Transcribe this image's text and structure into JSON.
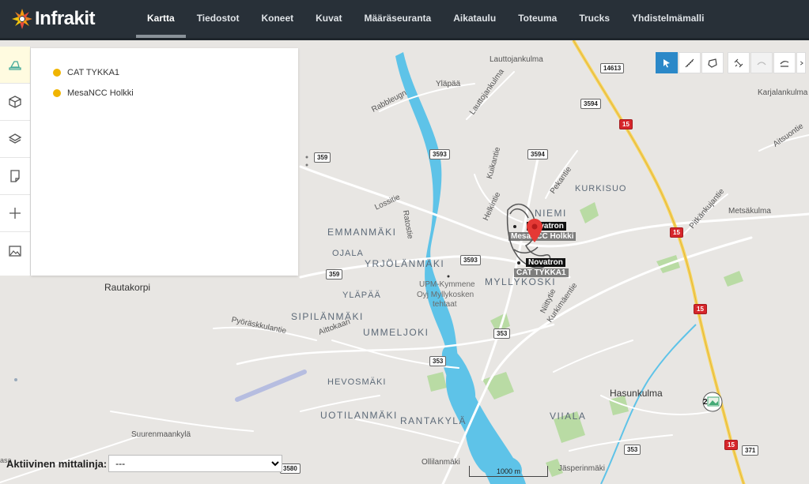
{
  "app": {
    "name": "Infrakit"
  },
  "nav": {
    "items": [
      {
        "label": "Kartta",
        "active": true
      },
      {
        "label": "Tiedostot",
        "active": false
      },
      {
        "label": "Koneet",
        "active": false
      },
      {
        "label": "Kuvat",
        "active": false
      },
      {
        "label": "Määräseuranta",
        "active": false
      },
      {
        "label": "Aikataulu",
        "active": false
      },
      {
        "label": "Toteuma",
        "active": false
      },
      {
        "label": "Trucks",
        "active": false
      },
      {
        "label": "Yhdistelmämalli",
        "active": false
      }
    ]
  },
  "left_tools": [
    {
      "icon": "machines-icon",
      "active": true
    },
    {
      "icon": "cube-icon",
      "active": false
    },
    {
      "icon": "layers-icon",
      "active": false
    },
    {
      "icon": "note-icon",
      "active": false
    },
    {
      "icon": "crosshair-icon",
      "active": false
    },
    {
      "icon": "image-icon",
      "active": false
    }
  ],
  "legend": {
    "items": [
      {
        "label": "CAT TYKKA1",
        "color": "#f0b400"
      },
      {
        "label": "MesaNCC Holkki",
        "color": "#f0b400"
      }
    ]
  },
  "map_tools": [
    {
      "icon": "pointer-icon",
      "active": true
    },
    {
      "icon": "measure-line-icon",
      "active": false
    },
    {
      "icon": "measure-area-icon",
      "active": false
    },
    {
      "icon": "satellite-icon",
      "active": false
    },
    {
      "icon": "profile-icon",
      "active": false
    },
    {
      "icon": "cross-section-icon",
      "active": false
    },
    {
      "icon": "more-icon",
      "active": false
    }
  ],
  "map": {
    "places": {
      "lauttojankulma": "Lauttojankulma",
      "ylapaa_top": "Yläpää",
      "rabbleugn": "Rabbleugn",
      "lauttojankulma_road": "Lauttojankulma",
      "karjalankulma": "Karjalankulma",
      "aitsuontie": "Aitsuontie",
      "kurkisuo": "KURKISUO",
      "pekantie": "Pekantie",
      "kuikantie": "Kuikantie",
      "helkintie": "Helkintie",
      "lossitie": "Lossitie",
      "ratostie": "Ratostie",
      "emmanmaki": "EMMANMÄKI",
      "ojala": "OJALA",
      "yrjolanmaki": "YRJÖLÄNMÄKI",
      "niemi": "NIEMI",
      "myllykoski": "MYLLYKOSKI",
      "metsakulma": "Metsäkulma",
      "pitkankujantie": "Pitkänkujantie",
      "rautakorpi": "Rautakorpi",
      "ylapaa": "YLÄPÄÄ",
      "upm_1": "UPM-Kymmene",
      "upm_2": "Oyj Myllykosken",
      "upm_3": "tehtaat",
      "niittytie": "Niittytie",
      "kurkimaentie": "Kurkimäentie",
      "sipilanmaki": "SIPILÄNMÄKI",
      "ummeljoki": "UMMELJOKI",
      "pyorakkulantie": "Pyöräskkulantie",
      "aittokaari": "Aittokaari",
      "hevosmaki": "HEVOSMÄKI",
      "hasunkulma": "Hasunkulma",
      "uotilanmaki": "UOTILANMÄKI",
      "rantakyla": "RANTAKYLÄ",
      "viiala": "VIIALA",
      "suurenmaankyla": "Suurenmaankylä",
      "ollilanmaki": "Ollilanmäki",
      "jasperinmaki": "Jäsperinmäki",
      "asa": "asa"
    },
    "roads": {
      "r14613": "14613",
      "r3594a": "3594",
      "r15a": "15",
      "r3593a": "3593",
      "r3594b": "3594",
      "r359a": "359",
      "r3593b": "3593",
      "r359b": "359",
      "r15b": "15",
      "r15c": "15",
      "r353a": "353",
      "r353b": "353",
      "r353c": "353",
      "r15d": "15",
      "r371": "371",
      "r3580": "3580"
    },
    "machines": {
      "novatron_top": "Novatron",
      "mesa_holkki": "MesaNCC Holkki",
      "novatron_bottom": "Novatron",
      "cat_tykka": "CAT TYKKA1"
    },
    "cluster_count": "2",
    "scale": "1000 m"
  },
  "active_line": {
    "label": "Aktiivinen mittalinja:",
    "value": "---"
  },
  "colors": {
    "topbar": "#283038",
    "accent": "#2b88c8",
    "water": "#5ec3e8",
    "legend_dot": "#f0b400"
  }
}
